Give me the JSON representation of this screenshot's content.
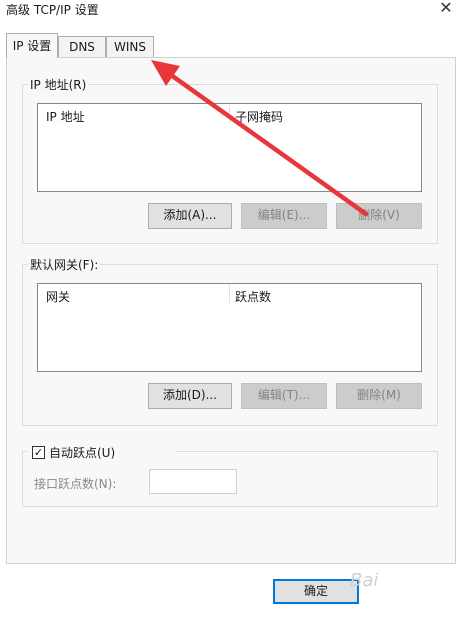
{
  "window": {
    "title": "高级 TCP/IP 设置",
    "close_glyph": "✕"
  },
  "tabs": [
    {
      "label": "IP 设置",
      "active": true
    },
    {
      "label": "DNS",
      "active": false
    },
    {
      "label": "WINS",
      "active": false
    }
  ],
  "ip_group": {
    "label": "IP 地址(R)",
    "columns": [
      "IP 地址",
      "子网掩码"
    ],
    "buttons": {
      "add": "添加(A)...",
      "edit": "编辑(E)...",
      "delete": "删除(V)"
    }
  },
  "gateway_group": {
    "label": "默认网关(F):",
    "columns": [
      "网关",
      "跃点数"
    ],
    "buttons": {
      "add": "添加(D)...",
      "edit": "编辑(T)...",
      "delete": "删除(M)"
    }
  },
  "metric_group": {
    "auto_metric_label": "自动跃点(U)",
    "auto_metric_checked": true,
    "checkmark_glyph": "✓",
    "interface_metric_label": "接口跃点数(N):",
    "interface_metric_value": ""
  },
  "footer": {
    "ok_label": "确定"
  },
  "annotation": {
    "arrow_color": "#e8373b"
  }
}
